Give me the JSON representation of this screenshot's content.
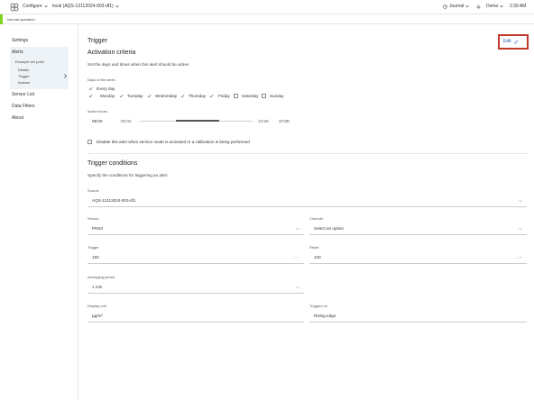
{
  "topbar": {
    "configure_label": "Configure",
    "device_label": "local (AQS-12112024-003-df1)",
    "journal_label": "Journal",
    "user_label": "Demo",
    "time": "2:30 AM"
  },
  "status": {
    "text": "Normal operation",
    "color": "#7ed321"
  },
  "sidebar": {
    "settings": "Settings",
    "alerts": "Alerts",
    "example": "Example set point",
    "details": "Details",
    "trigger": "Trigger",
    "actions": "Actions",
    "sensor_list": "Sensor List",
    "data_filters": "Data Filters",
    "about": "About"
  },
  "trigger_section": {
    "title": "Trigger",
    "edit_label": "Edit",
    "activation_title": "Activation criteria",
    "activation_desc": "Set the days and times when this alert should be active.",
    "days_label": "Days of the week",
    "every_day": "Every day",
    "days": [
      {
        "label": "Monday",
        "checked": true
      },
      {
        "label": "Tuesday",
        "checked": true
      },
      {
        "label": "Wednesday",
        "checked": true
      },
      {
        "label": "Thursday",
        "checked": true
      },
      {
        "label": "Friday",
        "checked": true
      },
      {
        "label": "Saturday",
        "checked": false
      },
      {
        "label": "Sunday",
        "checked": false
      }
    ],
    "active_hours_label": "Active hours",
    "start_time": "08:00",
    "range_min": "00:00",
    "range_max": "23:59",
    "end_time": "17:00",
    "disable_label": "Disable this alert when service mode is activated or a calibration is being performed"
  },
  "conditions": {
    "title": "Trigger conditions",
    "desc": "Specify the conditions for triggering an alert.",
    "source_label": "Source",
    "source_value": "AQS-12112024-003-df1",
    "sensor_label": "Sensor",
    "sensor_value": "PM10",
    "channel_label": "Channel",
    "channel_value": "Select an option",
    "trigger_label": "Trigger",
    "trigger_value": "150",
    "reset_label": "Reset",
    "reset_value": "130",
    "avg_label": "Averaging period",
    "avg_value": "1 min",
    "unit_label": "Display unit",
    "unit_value": "µg/m³",
    "triggers_on_label": "Triggers on",
    "triggers_on_value": "Rising edge",
    "stepper_glyph": "– | +"
  }
}
